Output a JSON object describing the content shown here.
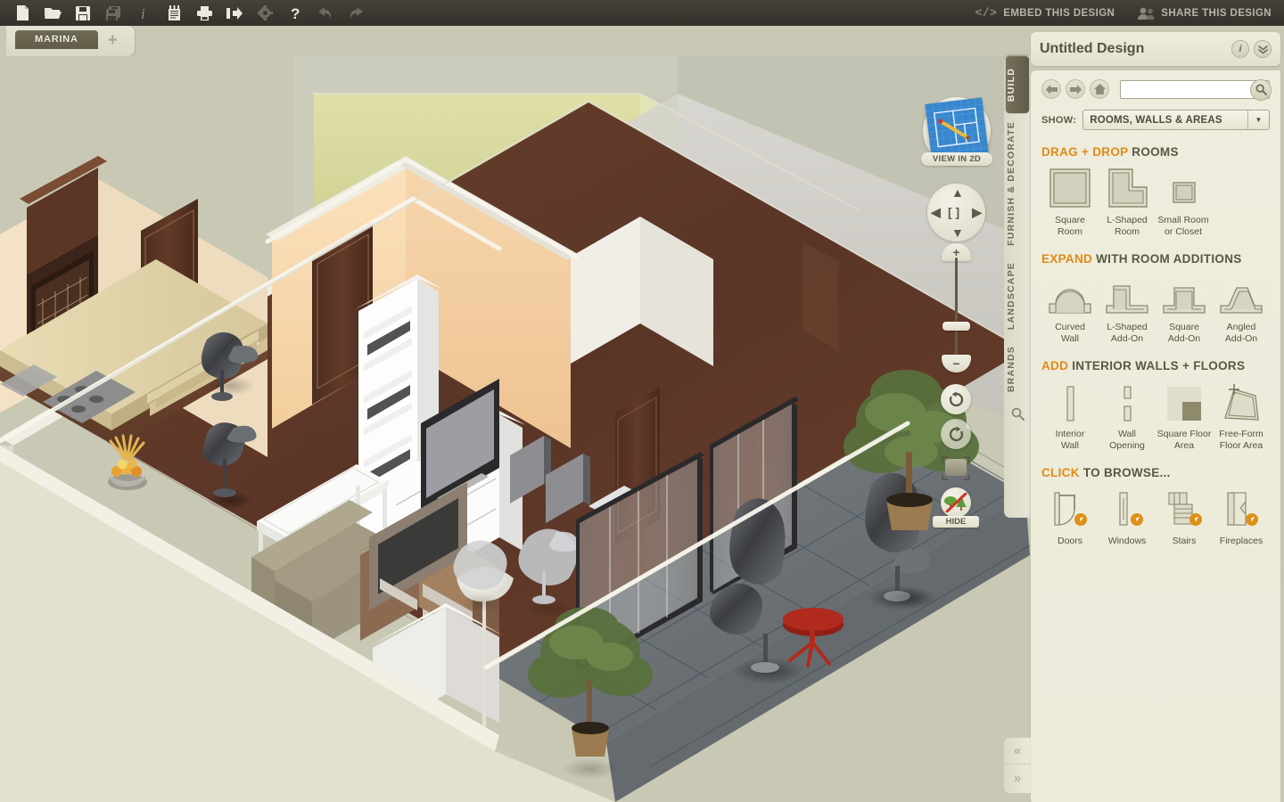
{
  "toolbar": {
    "icons": [
      {
        "name": "new-document-icon",
        "label": "New",
        "dim": false
      },
      {
        "name": "open-folder-icon",
        "label": "Open",
        "dim": false
      },
      {
        "name": "save-icon",
        "label": "Save",
        "dim": false
      },
      {
        "name": "save-as-icon",
        "label": "Save As",
        "dim": true
      },
      {
        "name": "info-icon",
        "label": "Info",
        "dim": true
      },
      {
        "name": "notes-icon",
        "label": "Notes",
        "dim": false
      },
      {
        "name": "print-icon",
        "label": "Print",
        "dim": false
      },
      {
        "name": "export-icon",
        "label": "Export",
        "dim": false
      },
      {
        "name": "settings-gear-icon",
        "label": "Settings",
        "dim": true
      },
      {
        "name": "help-icon",
        "label": "Help",
        "dim": false
      },
      {
        "name": "undo-icon",
        "label": "Undo",
        "dim": true
      },
      {
        "name": "redo-icon",
        "label": "Redo",
        "dim": true
      }
    ],
    "embed_label": "EMBED THIS DESIGN",
    "share_label": "SHARE THIS DESIGN"
  },
  "tabs": {
    "documents": [
      "MARINA"
    ],
    "add_label": "+"
  },
  "viewport": {
    "view_2d_label": "VIEW IN 2D",
    "hide_label": "HIDE",
    "rail_tabs": [
      {
        "label": "BUILD",
        "active": true
      },
      {
        "label": "FURNISH & DECORATE",
        "active": false
      },
      {
        "label": "LANDSCAPE",
        "active": false
      },
      {
        "label": "BRANDS",
        "active": false
      }
    ],
    "nav": {
      "up": "▲",
      "down": "▼",
      "left": "◀",
      "right": "▶",
      "center": "[ ]"
    },
    "zoom": {
      "plus": "+",
      "minus": "−"
    },
    "collapse_left": "«",
    "collapse_right": "»"
  },
  "panel": {
    "title": "Untitled Design",
    "info_label": "i",
    "collapse_label": "»",
    "search": {
      "value": "",
      "placeholder": ""
    },
    "show": {
      "label": "SHOW:",
      "value": "ROOMS, WALLS & AREAS"
    },
    "sections": [
      {
        "accent": "DRAG + DROP",
        "rest": "ROOMS",
        "key": "rooms",
        "items": [
          {
            "name": "square-room",
            "label": "Square\nRoom",
            "line1": "Square",
            "line2": "Room"
          },
          {
            "name": "l-shaped-room",
            "label": "L-Shaped Room",
            "line1": "L-Shaped",
            "line2": "Room"
          },
          {
            "name": "small-room-or-closet",
            "label": "Small Room or Closet",
            "line1": "Small Room",
            "line2": "or Closet"
          }
        ]
      },
      {
        "accent": "EXPAND",
        "rest": "WITH ROOM ADDITIONS",
        "key": "adds",
        "items": [
          {
            "name": "curved-wall",
            "line1": "Curved",
            "line2": "Wall"
          },
          {
            "name": "l-shaped-add-on",
            "line1": "L-Shaped",
            "line2": "Add-On"
          },
          {
            "name": "square-add-on",
            "line1": "Square",
            "line2": "Add-On"
          },
          {
            "name": "angled-add-on",
            "line1": "Angled",
            "line2": "Add-On"
          }
        ]
      },
      {
        "accent": "ADD",
        "rest": "INTERIOR WALLS + FLOORS",
        "key": "walls",
        "items": [
          {
            "name": "interior-wall",
            "line1": "Interior",
            "line2": "Wall"
          },
          {
            "name": "wall-opening",
            "line1": "Wall",
            "line2": "Opening"
          },
          {
            "name": "square-floor-area",
            "line1": "Square Floor",
            "line2": "Area"
          },
          {
            "name": "free-form-floor-area",
            "line1": "Free-Form",
            "line2": "Floor Area"
          }
        ]
      },
      {
        "accent": "CLICK",
        "rest": "TO BROWSE...",
        "key": "browse",
        "items": [
          {
            "name": "doors",
            "line1": "Doors",
            "line2": ""
          },
          {
            "name": "windows",
            "line1": "Windows",
            "line2": ""
          },
          {
            "name": "stairs",
            "line1": "Stairs",
            "line2": ""
          },
          {
            "name": "fireplaces",
            "line1": "Fireplaces",
            "line2": ""
          }
        ]
      }
    ]
  },
  "colors": {
    "accent_orange": "#e08a18",
    "panel_bg": "#eeecdc",
    "chrome_bg": "#c9c8b4",
    "toolbar_bg": "#3b3932",
    "active_tab": "#655f4a",
    "wall_peach": "#f7d7ab",
    "wall_olive": "#d8d99a",
    "wall_white": "#f2f0ea",
    "floor_wood": "#5f3a2a",
    "patio_grey": "#6d7276"
  }
}
